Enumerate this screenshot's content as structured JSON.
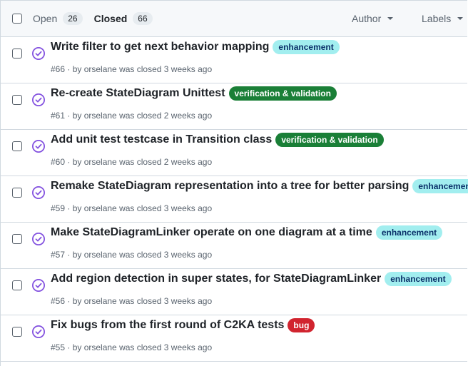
{
  "header": {
    "open_label": "Open",
    "open_count": "26",
    "closed_label": "Closed",
    "closed_count": "66",
    "author_filter": "Author",
    "labels_filter": "Labels"
  },
  "colors": {
    "closed_icon": "#8250df",
    "enhancement_bg": "#a2eeef",
    "enhancement_fg": "#0a3069",
    "verification_bg": "#1a7f37",
    "verification_fg": "#ffffff",
    "bug_bg": "#d1242f",
    "bug_fg": "#ffffff"
  },
  "issues": [
    {
      "title": "Write filter to get next behavior mapping",
      "label": "enhancement",
      "number": "#66",
      "by": " · by ",
      "author": "orselane",
      "closed": " was closed 3 weeks ago"
    },
    {
      "title": "Re-create StateDiagram Unittest",
      "label": "verification & validation",
      "number": "#61",
      "by": " · by ",
      "author": "orselane",
      "closed": " was closed 2 weeks ago"
    },
    {
      "title": "Add unit test testcase in Transition class",
      "label": "verification & validation",
      "number": "#60",
      "by": " · by ",
      "author": "orselane",
      "closed": " was closed 2 weeks ago"
    },
    {
      "title": "Remake StateDiagram representation into a tree for better parsing",
      "label": "enhancement",
      "number": "#59",
      "by": " · by ",
      "author": "orselane",
      "closed": " was closed 3 weeks ago"
    },
    {
      "title": "Make StateDiagramLinker operate on one diagram at a time",
      "label": "enhancement",
      "number": "#57",
      "by": " · by ",
      "author": "orselane",
      "closed": " was closed 3 weeks ago"
    },
    {
      "title": "Add region detection in super states, for StateDiagramLinker",
      "label": "enhancement",
      "number": "#56",
      "by": " · by ",
      "author": "orselane",
      "closed": " was closed 3 weeks ago"
    },
    {
      "title": "Fix bugs from the first round of C2KA tests",
      "label": "bug",
      "number": "#55",
      "by": " · by ",
      "author": "orselane",
      "closed": " was closed 3 weeks ago"
    }
  ]
}
